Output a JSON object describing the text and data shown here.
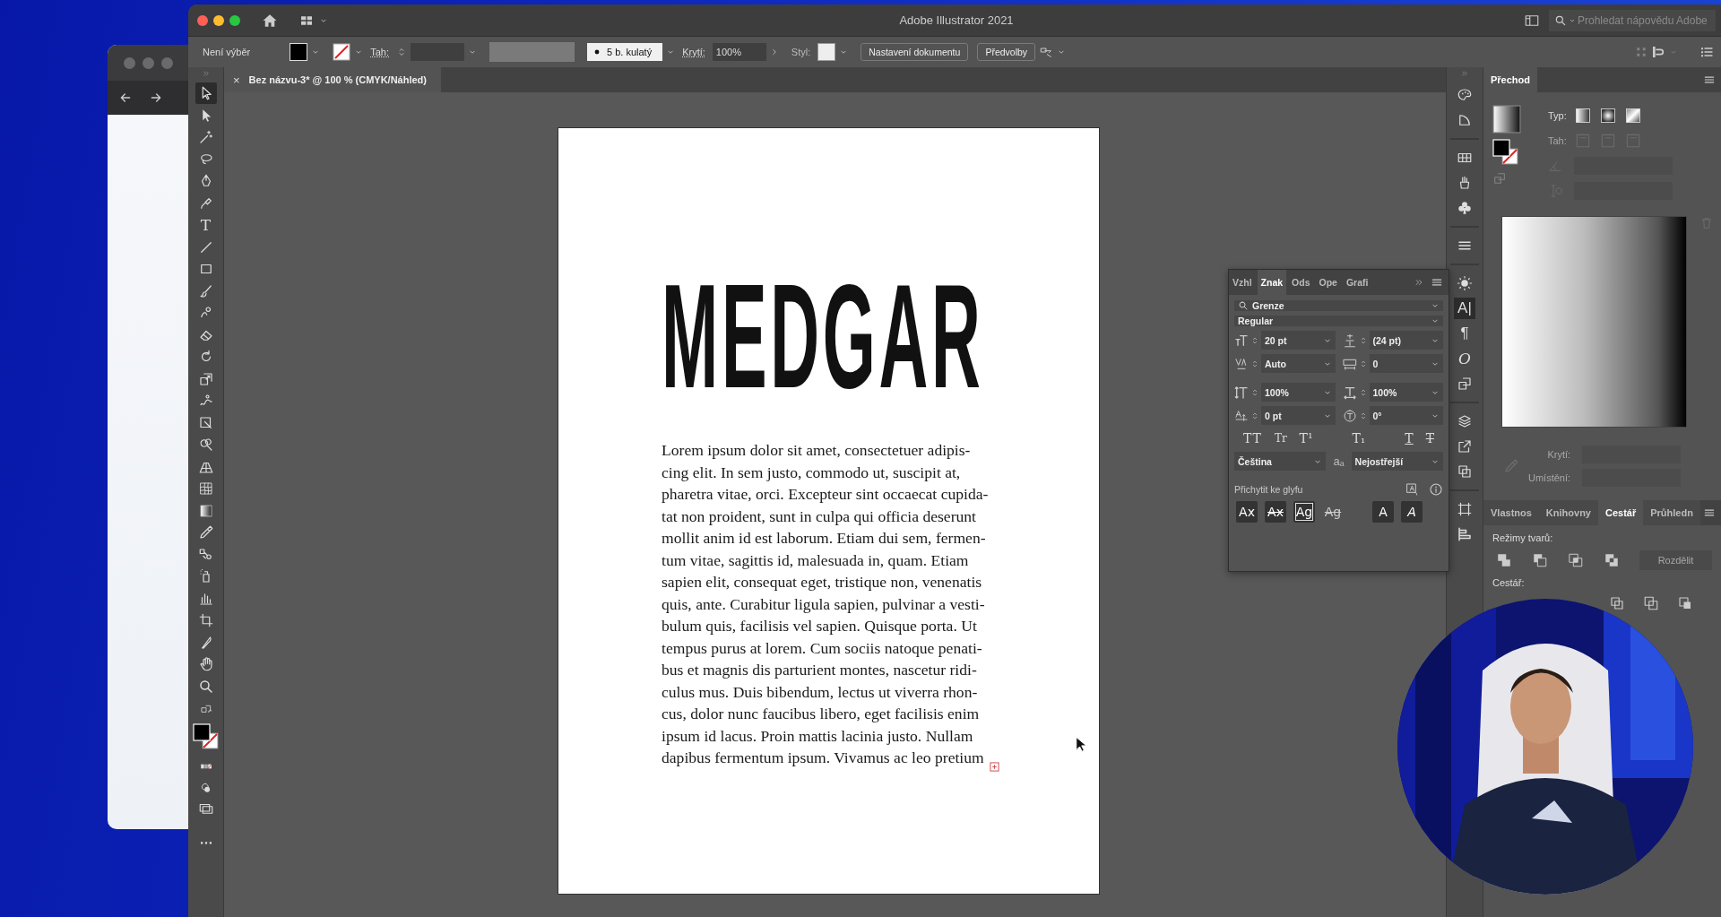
{
  "window": {
    "title": "Adobe Illustrator 2021",
    "help_search": {
      "placeholder": "Prohledat nápovědu Adobe"
    }
  },
  "control_bar": {
    "selection": "Není výběr",
    "stroke_label": "Tah:",
    "brush": "5 b. kulatý",
    "opacity_label": "Krytí:",
    "opacity": "100%",
    "style_label": "Styl:",
    "buttons": [
      "Nastavení dokumentu",
      "Předvolby"
    ]
  },
  "document_tabs": [
    {
      "close": "×",
      "label": "Bez názvu-3* @ 100 % (CMYK/Náhled)",
      "selected": true
    }
  ],
  "toolbar": {
    "tools": [
      {
        "selected": true
      },
      {
        "selected": false
      },
      {
        "selected": false
      },
      {
        "selected": false
      },
      {
        "selected": false
      },
      {
        "selected": false
      },
      {
        "glyph": "T",
        "selected": false
      },
      {
        "selected": false
      },
      {
        "selected": false
      },
      {
        "selected": false
      },
      {
        "selected": false
      },
      {
        "selected": false
      },
      {
        "selected": false
      },
      {
        "selected": false
      },
      {
        "selected": false
      },
      {
        "selected": false
      },
      {
        "selected": false
      },
      {
        "selected": false
      },
      {
        "selected": false
      },
      {
        "selected": false
      },
      {
        "selected": false
      },
      {
        "selected": false
      },
      {
        "selected": false
      },
      {
        "selected": false
      },
      {
        "selected": false
      },
      {
        "selected": false
      },
      {
        "selected": false
      },
      {
        "selected": false
      }
    ]
  },
  "artboard": {
    "heading": "MEDGAR",
    "body_lines": [
      "Lorem ipsum dolor sit amet, consectetuer adipis-",
      "cing elit. In sem justo, commodo ut, suscipit at,",
      "pharetra vitae, orci. Excepteur sint occaecat cupida-",
      "tat non proident, sunt in culpa qui officia deserunt",
      "mollit anim id est laborum. Etiam dui sem, fermen-",
      "tum vitae, sagittis id, malesuada in, quam. Etiam",
      "sapien elit, consequat eget, tristique non, venenatis",
      "quis, ante. Curabitur ligula sapien, pulvinar a vesti-",
      "bulum quis, facilisis vel sapien. Quisque porta. Ut",
      "tempus purus at lorem. Cum sociis natoque penati-",
      "bus et magnis dis parturient montes, nascetur ridi-",
      "culus mus. Duis bibendum, lectus ut viverra rhon-",
      "cus, dolor nunc faucibus libero, eget facilisis enim",
      "ipsum id lacus. Proin mattis lacinia justo. Nullam",
      "dapibus fermentum ipsum. Vivamus ac leo pretium"
    ]
  },
  "character_panel": {
    "tabs": [
      {
        "label": "Vzhl",
        "selected": false
      },
      {
        "label": "Znak",
        "selected": true
      },
      {
        "label": "Ods",
        "selected": false
      },
      {
        "label": "Ope",
        "selected": false
      },
      {
        "label": "Grafi",
        "selected": false
      }
    ],
    "font_family": "Grenze",
    "font_style": "Regular",
    "font_size": "20 pt",
    "leading": "(24 pt)",
    "kerning": "Auto",
    "tracking": "0",
    "vertical_scale": "100%",
    "horizontal_scale": "100%",
    "baseline_shift": "0 pt",
    "rotation": "0°",
    "type_buttons": [
      {
        "label": "TT",
        "kind": "caps"
      },
      {
        "label": "Tr",
        "kind": "smallcaps"
      },
      {
        "label": "T¹",
        "kind": "super"
      },
      {
        "label": "T₁",
        "kind": "sub"
      },
      {
        "label": "T",
        "kind": "underline"
      },
      {
        "label": "T",
        "kind": "strike"
      }
    ],
    "language": "Čeština",
    "antialias_glyph": "aₐ",
    "antialias": "Nejostřejší",
    "snap_label": "Přichytit ke glyfu",
    "snap_buttons": [
      {
        "label": "Ax",
        "kind": "plain",
        "on": true
      },
      {
        "label": "Ax",
        "kind": "struck",
        "on": true
      },
      {
        "label": "Ag",
        "kind": "boxed",
        "on": true
      },
      {
        "label": "Ag",
        "kind": "struck",
        "on": false
      },
      {
        "label": "A",
        "kind": "plain",
        "on": true
      },
      {
        "label": "A",
        "kind": "italic",
        "on": true
      }
    ]
  },
  "right_strip": {
    "items": [
      {
        "selected": false
      },
      {
        "selected": false
      },
      {
        "selected": false
      },
      {
        "selected": false
      },
      {
        "selected": false
      },
      {
        "selected": false
      },
      {
        "selected": false
      },
      {
        "glyph": "A|",
        "selected": true
      },
      {
        "glyph": "¶",
        "selected": false
      },
      {
        "glyph": "O",
        "selected": false
      },
      {
        "selected": false
      },
      {
        "selected": false
      },
      {
        "selected": false
      },
      {
        "selected": false
      },
      {
        "selected": false
      },
      {
        "selected": false
      }
    ]
  },
  "gradient_panel": {
    "tab": "Přechod",
    "type_label": "Typ:",
    "stroke": {
      "label": "Tah:",
      "disabled": true
    },
    "opacity": {
      "label": "Krytí:",
      "disabled": true
    },
    "location": {
      "label": "Umístění:",
      "disabled": true
    }
  },
  "lower_panel": {
    "tabs": [
      {
        "label": "Vlastnos",
        "selected": false
      },
      {
        "label": "Knihovny",
        "selected": false
      },
      {
        "label": "Cestář",
        "selected": true
      },
      {
        "label": "Průhledn",
        "selected": false
      }
    ],
    "shape_modes_label": "Režimy tvarů:",
    "expand_button": {
      "label": "Rozdělit",
      "disabled": true
    },
    "pathfinders_label": "Cestář:"
  }
}
